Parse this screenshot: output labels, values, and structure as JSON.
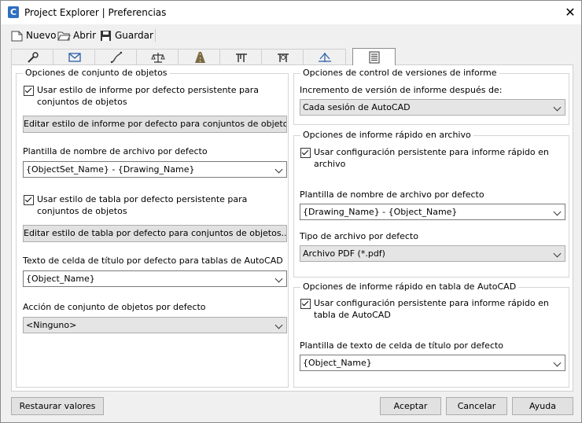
{
  "window": {
    "title": "Project Explorer | Preferencias",
    "app_icon_letter": "C",
    "close_glyph": "✕"
  },
  "toolbar": {
    "new_label": "Nuevo",
    "open_label": "Abrir",
    "save_label": "Guardar"
  },
  "tabs": [
    {
      "icon": "wrench-icon"
    },
    {
      "icon": "envelope-icon"
    },
    {
      "icon": "alignment-icon"
    },
    {
      "icon": "scale-icon"
    },
    {
      "icon": "road-icon"
    },
    {
      "icon": "pipe-network-icon"
    },
    {
      "icon": "pressure-network-icon"
    },
    {
      "icon": "profile-icon"
    },
    {
      "icon": "report-icon",
      "active": true
    }
  ],
  "left": {
    "group_title": "Opciones de conjunto de objetos",
    "chk_report_label": "Usar estilo de informe por defecto persistente para conjuntos de objetos",
    "btn_edit_report": "Editar estilo de informe por defecto para conjuntos de objetos...",
    "filename_template_label": "Plantilla de nombre de archivo por defecto",
    "filename_template_value": "{ObjectSet_Name} - {Drawing_Name}",
    "chk_table_label": "Usar estilo de tabla por defecto persistente para conjuntos de objetos",
    "btn_edit_table": "Editar estilo de tabla por defecto para conjuntos de objetos...",
    "cell_text_label": "Texto de celda de título por defecto para tablas de AutoCAD",
    "cell_text_value": "{Object_Name}",
    "action_label": "Acción de conjunto de objetos por defecto",
    "action_value": "<Ninguno>"
  },
  "version": {
    "group_title": "Opciones de control de versiones de informe",
    "increment_label": "Incremento de versión de informe después de:",
    "increment_value": "Cada sesión de AutoCAD"
  },
  "quick_file": {
    "group_title": "Opciones de informe rápido en archivo",
    "chk_label": "Usar configuración persistente para informe rápido en archivo",
    "filename_label": "Plantilla de nombre de archivo por defecto",
    "filename_value": "{Drawing_Name} - {Object_Name}",
    "filetype_label": "Tipo de archivo por defecto",
    "filetype_value": "Archivo PDF (*.pdf)"
  },
  "quick_table": {
    "group_title": "Opciones de informe rápido en tabla de AutoCAD",
    "chk_label": "Usar configuración persistente para informe rápido en tabla de AutoCAD",
    "cell_label": "Plantilla de texto de celda de título por defecto",
    "cell_value": "{Object_Name}"
  },
  "footer": {
    "restore_label": "Restaurar valores",
    "accept_label": "Aceptar",
    "cancel_label": "Cancelar",
    "help_label": "Ayuda"
  }
}
